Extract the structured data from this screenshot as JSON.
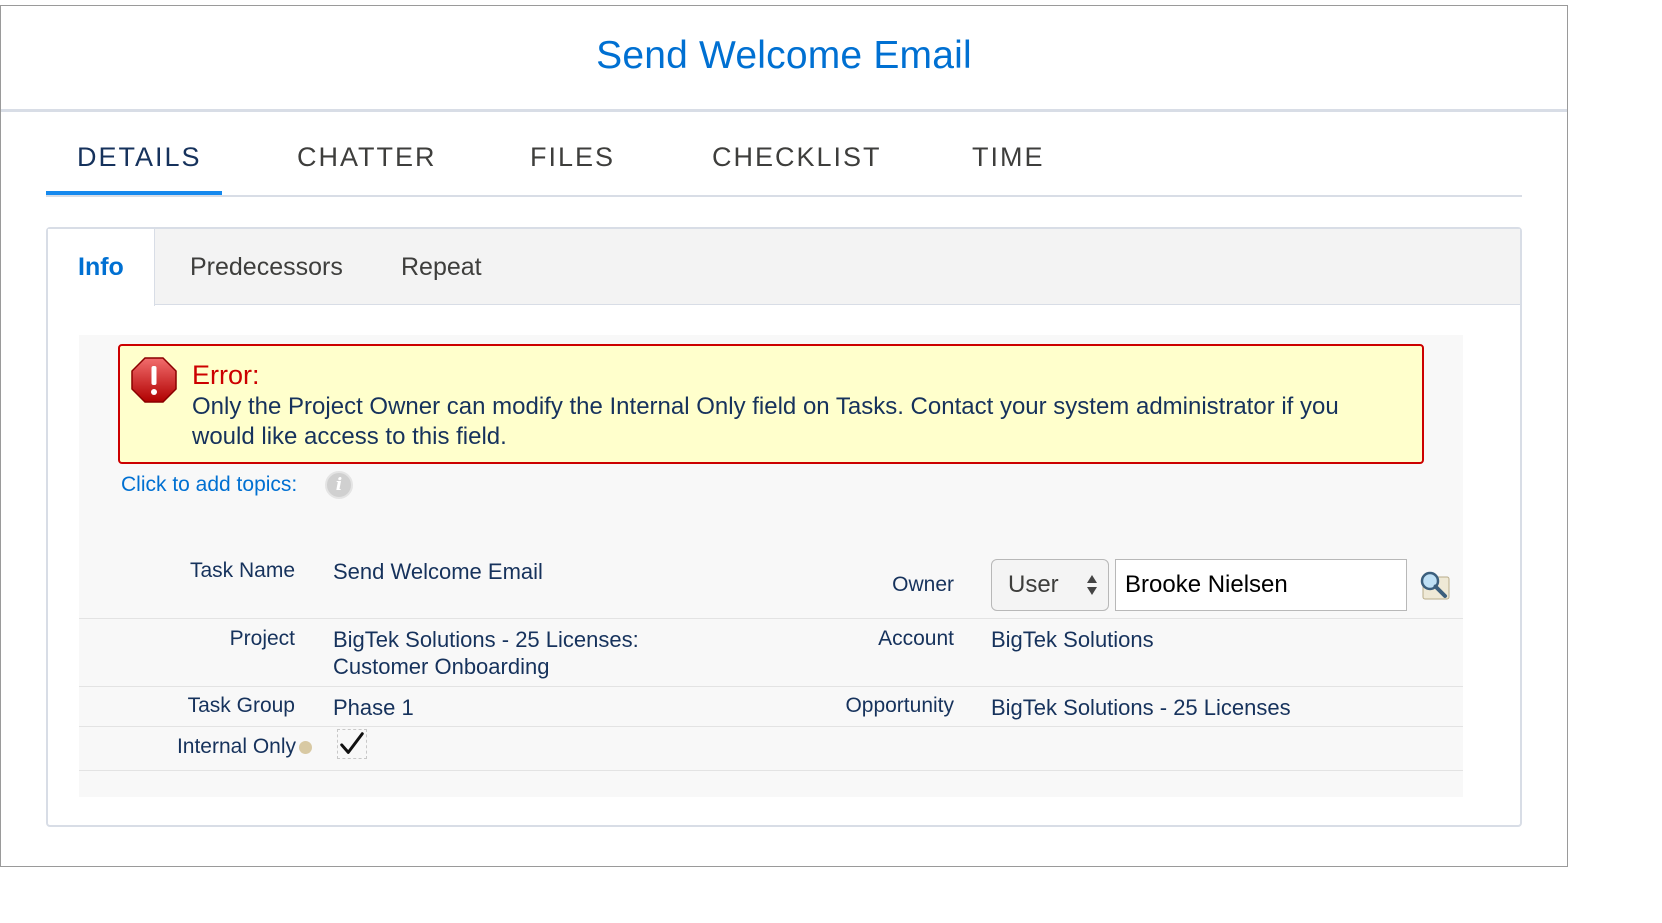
{
  "header": {
    "title": "Send Welcome Email"
  },
  "main_tabs": [
    {
      "label": "DETAILS",
      "active": true
    },
    {
      "label": "CHATTER",
      "active": false
    },
    {
      "label": "FILES",
      "active": false
    },
    {
      "label": "CHECKLIST",
      "active": false
    },
    {
      "label": "TIME",
      "active": false
    }
  ],
  "sub_tabs": [
    {
      "label": "Info",
      "active": true
    },
    {
      "label": "Predecessors",
      "active": false
    },
    {
      "label": "Repeat",
      "active": false
    }
  ],
  "error": {
    "title": "Error:",
    "message": "Only the Project Owner can modify the Internal Only field on Tasks. Contact your system administrator if you would like access to this field."
  },
  "topics": {
    "link_label": "Click to add topics:",
    "info_icon": "info-icon"
  },
  "fields": {
    "task_name": {
      "label": "Task Name",
      "value": "Send Welcome Email"
    },
    "owner": {
      "label": "Owner",
      "type_value": "User",
      "value": "Brooke Nielsen"
    },
    "project": {
      "label": "Project",
      "value_line1": "BigTek Solutions - 25 Licenses:",
      "value_line2": "Customer Onboarding"
    },
    "account": {
      "label": "Account",
      "value": "BigTek Solutions"
    },
    "task_group": {
      "label": "Task Group",
      "value": "Phase 1"
    },
    "opportunity": {
      "label": "Opportunity",
      "value": "BigTek Solutions - 25 Licenses"
    },
    "internal_only": {
      "label": "Internal Only",
      "checked": true
    }
  },
  "colors": {
    "accent": "#0070d2",
    "tab_indicator": "#1589ee",
    "error_border": "#cc0000",
    "error_background": "#ffffcc"
  }
}
